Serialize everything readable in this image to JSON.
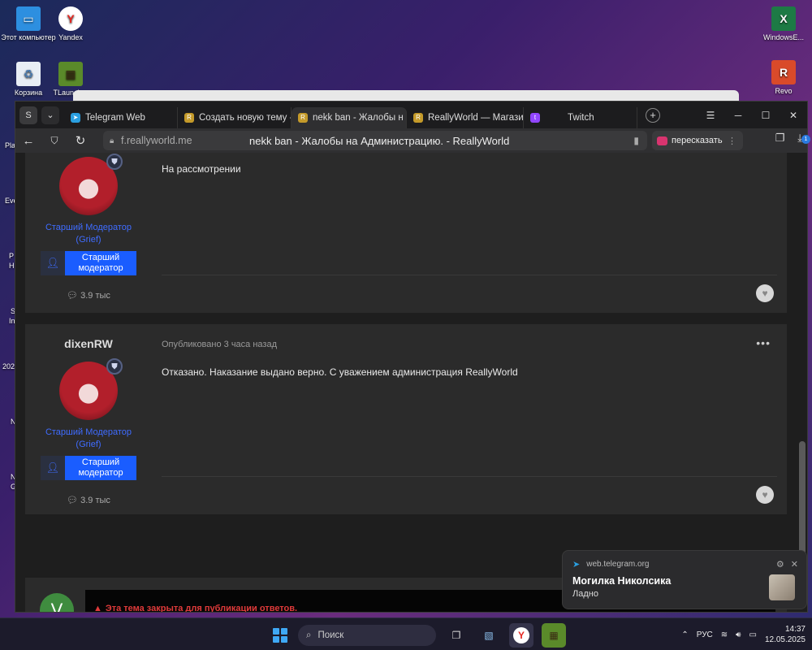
{
  "desktop": {
    "icons": [
      {
        "label": "Этот компьютер",
        "name": "this-pc"
      },
      {
        "label": "Yandex",
        "name": "yandex"
      },
      {
        "label": "Корзина",
        "name": "recycle-bin"
      },
      {
        "label": "TLauncher",
        "name": "tlauncher"
      },
      {
        "label": "WindowsE...",
        "name": "windows-excel"
      },
      {
        "label": "Revo",
        "name": "revo"
      }
    ],
    "cut_labels": [
      "Pla",
      "Eve",
      "P",
      "H",
      "S",
      "In",
      "202",
      "N",
      "N",
      "G"
    ]
  },
  "browser": {
    "tabs": [
      {
        "label": "Telegram Web",
        "favicon": "telegram-icon",
        "color": "#2a9fe0"
      },
      {
        "label": "Создать новую тему -",
        "favicon": "reallyworld-icon",
        "color": "#c49a2a"
      },
      {
        "label": "nekk ban - Жалобы н",
        "favicon": "reallyworld-icon",
        "color": "#c49a2a",
        "active": true
      },
      {
        "label": "ReallyWorld — Магазин",
        "favicon": "reallyworld-icon",
        "color": "#c49a2a"
      },
      {
        "label": "Twitch",
        "favicon": "twitch-icon",
        "color": "#9146ff"
      }
    ],
    "domain": "f.reallyworld.me",
    "page_title": "nekk ban - Жалобы на Администрацию. - ReallyWorld",
    "retell_label": "пересказать",
    "downloads_count": "1"
  },
  "posts": [
    {
      "author": "",
      "meta": "",
      "body": "На рассмотрении",
      "role_title_1": "Старший Модератор",
      "role_title_2": "(Grief)",
      "role_badge": "Старший модератор",
      "reputation": "3.9 тыс"
    },
    {
      "author": "dixenRW",
      "meta": "Опубликовано 3 часа назад",
      "body": "Отказано. Наказание выдано верно. С уважением администрация ReallyWorld",
      "role_title_1": "Старший Модератор",
      "role_title_2": "(Grief)",
      "role_badge": "Старший модератор",
      "reputation": "3.9 тыс"
    }
  ],
  "closed_notice": {
    "avatar_letter": "V",
    "text": "Эта тема закрыта для публикации ответов."
  },
  "notification": {
    "source": "web.telegram.org",
    "sender": "Могилка Николсика",
    "message": "Ладно"
  },
  "taskbar": {
    "search_label": "Поиск",
    "lang": "РУС",
    "time": "14:37",
    "date": "12.05.2025"
  },
  "colors": {
    "accent_blue": "#1a5dff",
    "role_text": "#3f6cff",
    "closed_red": "#e03a3a"
  }
}
